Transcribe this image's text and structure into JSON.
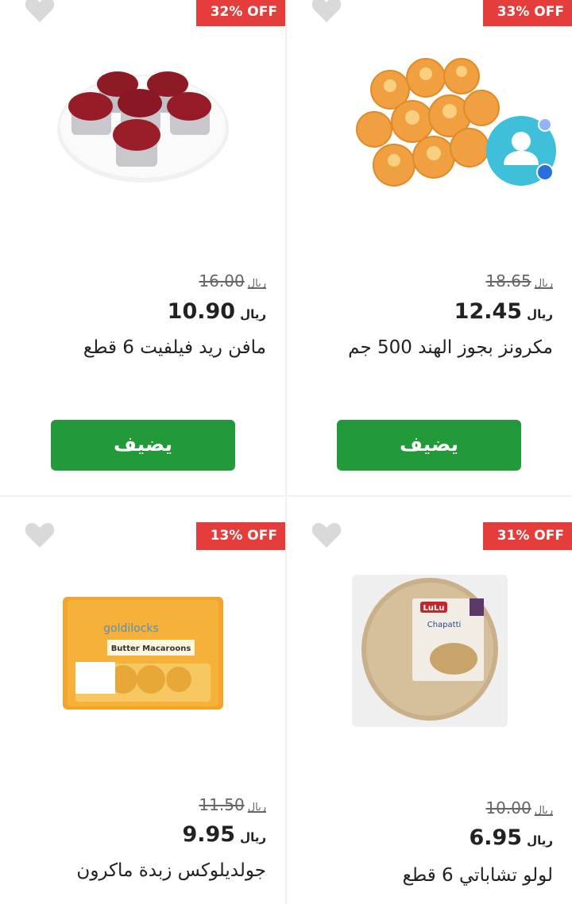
{
  "products": [
    {
      "discount": "32% OFF",
      "old_price": "16.00",
      "price": "10.90",
      "currency": "ريال",
      "name": "مافن ريد فيلفيت 6 قطع",
      "add_label": "يضيف",
      "image_icon": "red-velvet-muffins-image"
    },
    {
      "discount": "33% OFF",
      "old_price": "18.65",
      "price": "12.45",
      "currency": "ريال",
      "name": "مكرونز بجوز الهند 500 جم",
      "add_label": "يضيف",
      "image_icon": "coconut-macaroons-image"
    },
    {
      "discount": "13% OFF",
      "old_price": "11.50",
      "price": "9.95",
      "currency": "ريال",
      "name": "جولديلوكس زبدة ماكرون",
      "add_label": "",
      "image_icon": "butter-macaroons-pack-image",
      "pack_brand": "goldilocks",
      "pack_label": "Butter Macaroons"
    },
    {
      "discount": "31% OFF",
      "old_price": "10.00",
      "price": "6.95",
      "currency": "ريال",
      "name": "لولو تشاباتي 6 قطع",
      "add_label": "",
      "image_icon": "lulu-chapatti-pack-image",
      "pack_brand": "LuLu",
      "pack_label": "Chapatti"
    }
  ],
  "colors": {
    "badge": "#e53c3c",
    "add_button": "#229a3a",
    "heart": "#d9d9d9",
    "chat_bubble": "#3fbfd9"
  },
  "floating": {
    "icon": "chat-support-avatar-icon"
  }
}
